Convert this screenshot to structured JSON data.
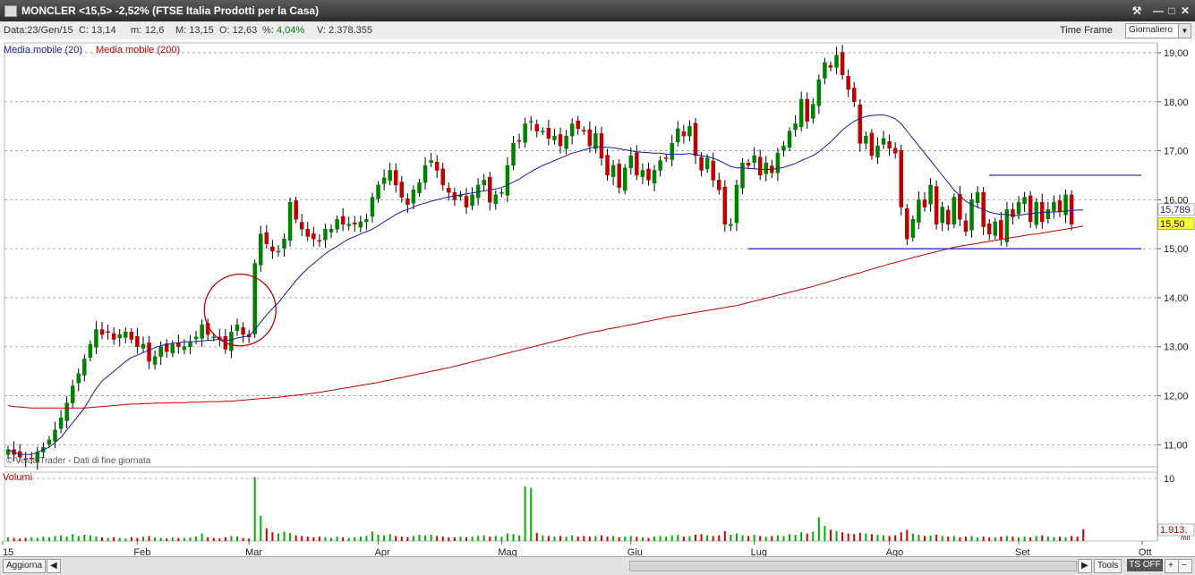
{
  "window": {
    "title": "MONCLER <15,5> -2,52%  (FTSE Italia Prodotti per la Casa)"
  },
  "infobar": {
    "date": "Data:23/Gen/15",
    "close": "C: 13,14",
    "min_label": "m:",
    "min": "12,6",
    "max": "M: 13,15",
    "open": "O: 12,63",
    "pct_label": "%:",
    "pct": "4,04%",
    "pct_color": "#008000",
    "volume": "V: 2.378.355",
    "time_frame_label": "Time Frame",
    "time_frame_value": "Giornaliero"
  },
  "legend": {
    "ma20": "Media mobile (20)",
    "ma200": "Media mobile (200)",
    "ma20_color": "#1a1aa0",
    "ma200_color": "#c00000"
  },
  "watermark": "© VisualTrader - Dati di fine giornata",
  "volume_panel": {
    "label": "Volumi",
    "axis_tick": "10",
    "last_value": "1.913.",
    "unit_tick": "mil"
  },
  "price_tags": {
    "ma20_value": "15,789",
    "last_price": "15,50"
  },
  "bottombar": {
    "refresh": "Aggiorna",
    "tools": "Tools",
    "ts": "TS OFF",
    "plus": "+",
    "minus": "−"
  },
  "chart_data": {
    "type": "candlestick",
    "y_ticks": [
      "19,00",
      "18,00",
      "17,00",
      "16,00",
      "15,00",
      "14,00",
      "13,00",
      "12,00",
      "11,00"
    ],
    "ylim": [
      10.55,
      19.2
    ],
    "x_labels": [
      "15",
      "Feb",
      "Mar",
      "Apr",
      "Mag",
      "Giu",
      "Lug",
      "Ago",
      "Set",
      "Ott"
    ],
    "x_label_sessions": [
      0,
      22,
      41,
      63,
      84,
      106,
      127,
      150,
      172,
      193
    ],
    "sessions": 196,
    "closes": [
      10.9,
      10.8,
      10.75,
      10.7,
      10.72,
      10.85,
      10.95,
      11.1,
      11.3,
      11.55,
      11.85,
      12.2,
      12.45,
      12.75,
      13.05,
      13.35,
      13.25,
      13.3,
      13.15,
      13.25,
      13.3,
      13.15,
      13.0,
      13.05,
      12.7,
      12.8,
      13.0,
      12.9,
      13.05,
      13.0,
      13.0,
      13.1,
      13.2,
      13.45,
      13.25,
      13.2,
      13.15,
      12.95,
      13.3,
      13.45,
      13.25,
      13.2,
      14.7,
      15.3,
      15.1,
      14.95,
      14.95,
      15.2,
      15.95,
      15.6,
      15.4,
      15.25,
      15.2,
      15.15,
      15.4,
      15.4,
      15.6,
      15.5,
      15.5,
      15.5,
      15.55,
      15.6,
      16.05,
      16.3,
      16.45,
      16.6,
      16.3,
      16.05,
      15.9,
      16.2,
      16.35,
      16.7,
      16.8,
      16.6,
      16.3,
      16.15,
      16.0,
      16.1,
      15.85,
      16.1,
      16.3,
      16.4,
      15.95,
      16.1,
      16.15,
      16.7,
      17.15,
      17.2,
      17.55,
      17.6,
      17.4,
      17.4,
      17.25,
      17.3,
      17.1,
      17.3,
      17.55,
      17.45,
      17.4,
      17.1,
      17.35,
      16.85,
      16.5,
      16.7,
      16.25,
      16.65,
      16.9,
      16.5,
      16.6,
      16.4,
      16.6,
      16.8,
      16.85,
      17.15,
      17.45,
      17.3,
      17.5,
      16.9,
      16.6,
      16.85,
      16.4,
      16.2,
      15.5,
      15.5,
      16.3,
      16.75,
      16.7,
      16.9,
      16.5,
      16.75,
      16.55,
      16.95,
      17.1,
      17.4,
      17.55,
      18.05,
      17.6,
      17.95,
      18.45,
      18.8,
      18.7,
      18.95,
      18.55,
      18.25,
      18.0,
      17.15,
      17.3,
      16.9,
      17.1,
      17.25,
      17.05,
      16.95,
      15.85,
      15.2,
      15.6,
      16.0,
      15.85,
      16.3,
      15.5,
      15.85,
      15.5,
      16.05,
      15.6,
      15.35,
      16.0,
      16.15,
      15.45,
      15.3,
      15.55,
      15.2,
      15.8,
      15.65,
      15.95,
      16.05,
      15.55,
      15.95,
      15.55,
      15.8,
      15.95,
      15.75,
      16.1,
      15.5
    ],
    "ma20": [
      10.9,
      10.85,
      10.8,
      10.8,
      10.8,
      10.85,
      10.9,
      10.95,
      11.05,
      11.15,
      11.3,
      11.45,
      11.6,
      11.75,
      11.95,
      12.15,
      12.3,
      12.4,
      12.5,
      12.6,
      12.7,
      12.78,
      12.83,
      12.88,
      12.93,
      12.98,
      13.02,
      13.05,
      13.07,
      13.08,
      13.1,
      13.1,
      13.11,
      13.12,
      13.13,
      13.14,
      13.15,
      13.13,
      13.14,
      13.18,
      13.2,
      13.22,
      13.35,
      13.5,
      13.65,
      13.78,
      13.9,
      14.05,
      14.2,
      14.35,
      14.48,
      14.6,
      14.7,
      14.8,
      14.9,
      14.98,
      15.05,
      15.13,
      15.2,
      15.25,
      15.3,
      15.35,
      15.4,
      15.47,
      15.55,
      15.62,
      15.7,
      15.76,
      15.8,
      15.85,
      15.9,
      15.93,
      15.97,
      16.0,
      16.03,
      16.06,
      16.08,
      16.1,
      16.12,
      16.14,
      16.16,
      16.18,
      16.2,
      16.22,
      16.25,
      16.3,
      16.36,
      16.42,
      16.5,
      16.57,
      16.64,
      16.7,
      16.75,
      16.8,
      16.85,
      16.9,
      16.95,
      16.98,
      17.02,
      17.05,
      17.08,
      17.08,
      17.07,
      17.06,
      17.04,
      17.02,
      17.0,
      16.98,
      16.97,
      16.96,
      16.95,
      16.95,
      16.93,
      16.93,
      16.93,
      16.93,
      16.94,
      16.92,
      16.9,
      16.88,
      16.85,
      16.8,
      16.74,
      16.68,
      16.65,
      16.65,
      16.64,
      16.63,
      16.62,
      16.62,
      16.62,
      16.64,
      16.66,
      16.7,
      16.74,
      16.8,
      16.85,
      16.9,
      16.98,
      17.08,
      17.18,
      17.3,
      17.42,
      17.52,
      17.6,
      17.66,
      17.7,
      17.72,
      17.73,
      17.73,
      17.7,
      17.65,
      17.55,
      17.4,
      17.25,
      17.1,
      16.95,
      16.8,
      16.65,
      16.5,
      16.35,
      16.2,
      16.08,
      15.97,
      15.9,
      15.85,
      15.8,
      15.75,
      15.72,
      15.7,
      15.7,
      15.68,
      15.68,
      15.7,
      15.72,
      15.73,
      15.74,
      15.75,
      15.75,
      15.76,
      15.77,
      15.78,
      15.79,
      15.79
    ],
    "ma200": [
      11.8,
      11.78,
      11.77,
      11.76,
      11.75,
      11.75,
      11.75,
      11.75,
      11.75,
      11.75,
      11.75,
      11.75,
      11.75,
      11.75,
      11.76,
      11.77,
      11.78,
      11.79,
      11.8,
      11.81,
      11.82,
      11.83,
      11.83,
      11.84,
      11.84,
      11.85,
      11.85,
      11.85,
      11.86,
      11.86,
      11.86,
      11.87,
      11.87,
      11.87,
      11.88,
      11.88,
      11.88,
      11.89,
      11.89,
      11.9,
      11.91,
      11.92,
      11.93,
      11.94,
      11.95,
      11.96,
      11.97,
      11.98,
      12.0,
      12.01,
      12.02,
      12.04,
      12.05,
      12.07,
      12.09,
      12.11,
      12.13,
      12.15,
      12.17,
      12.19,
      12.21,
      12.23,
      12.25,
      12.27,
      12.3,
      12.32,
      12.35,
      12.37,
      12.4,
      12.42,
      12.45,
      12.47,
      12.5,
      12.52,
      12.55,
      12.57,
      12.6,
      12.63,
      12.66,
      12.69,
      12.72,
      12.75,
      12.78,
      12.81,
      12.84,
      12.87,
      12.9,
      12.93,
      12.96,
      12.99,
      13.02,
      13.05,
      13.08,
      13.11,
      13.14,
      13.17,
      13.2,
      13.23,
      13.26,
      13.29,
      13.31,
      13.33,
      13.36,
      13.38,
      13.4,
      13.43,
      13.45,
      13.47,
      13.5,
      13.52,
      13.55,
      13.57,
      13.6,
      13.62,
      13.64,
      13.66,
      13.68,
      13.7,
      13.72,
      13.74,
      13.76,
      13.78,
      13.8,
      13.82,
      13.84,
      13.87,
      13.9,
      13.93,
      13.96,
      13.99,
      14.02,
      14.05,
      14.08,
      14.11,
      14.14,
      14.17,
      14.2,
      14.23,
      14.27,
      14.3,
      14.34,
      14.37,
      14.41,
      14.44,
      14.48,
      14.51,
      14.55,
      14.58,
      14.62,
      14.65,
      14.69,
      14.72,
      14.75,
      14.78,
      14.82,
      14.85,
      14.88,
      14.91,
      14.94,
      14.97,
      15.0,
      15.03,
      15.05,
      15.07,
      15.09,
      15.11,
      15.13,
      15.15,
      15.17,
      15.19,
      15.21,
      15.23,
      15.25,
      15.27,
      15.29,
      15.3,
      15.32,
      15.34,
      15.36,
      15.38,
      15.4,
      15.42,
      15.44,
      15.46
    ],
    "volumes": [
      0.6,
      0.5,
      0.4,
      0.5,
      0.6,
      0.5,
      0.7,
      0.6,
      0.8,
      0.9,
      0.7,
      1.1,
      0.8,
      1.0,
      0.9,
      0.7,
      0.6,
      0.5,
      0.6,
      0.5,
      0.4,
      0.6,
      0.5,
      0.7,
      0.8,
      0.6,
      0.5,
      0.4,
      0.6,
      0.5,
      0.5,
      0.6,
      0.7,
      1.2,
      0.6,
      0.5,
      0.4,
      0.6,
      0.8,
      0.7,
      0.5,
      0.4,
      10.2,
      4.0,
      2.0,
      1.4,
      1.2,
      1.5,
      1.3,
      0.9,
      0.8,
      0.7,
      0.6,
      0.7,
      0.6,
      0.5,
      0.7,
      0.6,
      0.5,
      0.6,
      0.7,
      0.8,
      1.5,
      1.0,
      0.9,
      1.1,
      0.8,
      0.7,
      0.6,
      0.8,
      1.0,
      0.9,
      1.0,
      0.8,
      0.7,
      0.6,
      0.6,
      0.7,
      0.6,
      0.7,
      0.8,
      0.9,
      0.7,
      0.8,
      0.7,
      1.2,
      1.1,
      0.9,
      8.7,
      8.5,
      1.3,
      0.9,
      0.8,
      0.7,
      0.8,
      0.7,
      0.9,
      0.7,
      0.8,
      0.7,
      0.8,
      0.9,
      0.7,
      0.8,
      0.6,
      0.7,
      0.8,
      0.7,
      0.6,
      0.5,
      0.7,
      0.8,
      0.7,
      0.9,
      1.0,
      0.7,
      0.8,
      1.0,
      1.1,
      0.9,
      0.8,
      0.9,
      1.6,
      1.0,
      1.2,
      0.9,
      0.8,
      1.0,
      0.8,
      0.7,
      0.8,
      0.9,
      0.8,
      1.1,
      1.0,
      1.4,
      1.2,
      1.5,
      3.8,
      2.4,
      1.8,
      1.6,
      1.4,
      1.2,
      1.1,
      1.3,
      1.2,
      1.1,
      1.0,
      0.9,
      0.8,
      0.9,
      1.4,
      1.8,
      1.2,
      1.0,
      0.8,
      0.9,
      1.0,
      0.8,
      0.7,
      0.8,
      0.6,
      0.7,
      0.8,
      0.6,
      0.7,
      0.6,
      0.6,
      0.7,
      0.8,
      0.7,
      0.6,
      0.7,
      0.6,
      0.8,
      0.9,
      0.7,
      0.6,
      0.7,
      0.6,
      0.8,
      0.7,
      1.9
    ],
    "volume_ylim": [
      0,
      11
    ],
    "trendlines": [
      {
        "from": [
          126,
          15.0
        ],
        "to": [
          196,
          15.0
        ]
      },
      {
        "from": [
          167,
          16.5
        ],
        "to": [
          209,
          16.5
        ]
      }
    ],
    "annotation": {
      "type": "circle",
      "cx_session": 39.5,
      "cy_price": 13.75,
      "r_px": 40
    }
  }
}
